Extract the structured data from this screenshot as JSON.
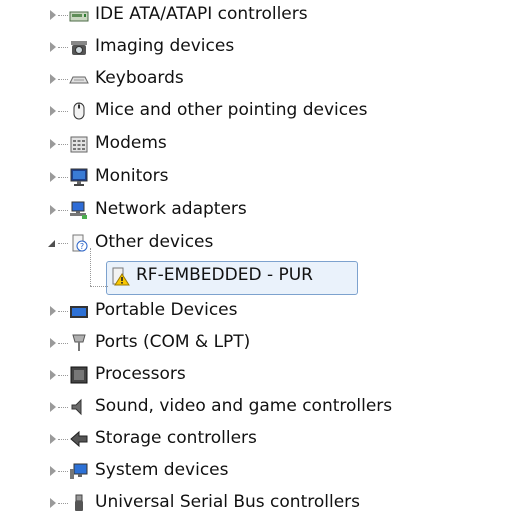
{
  "devices": [
    {
      "label": "IDE ATA/ATAPI controllers",
      "icon": "disk-controller-icon"
    },
    {
      "label": "Imaging devices",
      "icon": "camera-icon"
    },
    {
      "label": "Keyboards",
      "icon": "keyboard-icon"
    },
    {
      "label": "Mice and other pointing devices",
      "icon": "mouse-icon"
    },
    {
      "label": "Modems",
      "icon": "modem-icon"
    },
    {
      "label": "Monitors",
      "icon": "monitor-icon"
    },
    {
      "label": "Network adapters",
      "icon": "network-adapter-icon"
    },
    {
      "label": "Other devices",
      "icon": "unknown-device-icon",
      "expanded": true
    },
    {
      "label": "RF-EMBEDDED - PUR",
      "icon": "warning-device-icon",
      "child": true,
      "selected": true
    },
    {
      "label": "Portable Devices",
      "icon": "portable-device-icon"
    },
    {
      "label": "Ports (COM & LPT)",
      "icon": "port-icon"
    },
    {
      "label": "Processors",
      "icon": "processor-icon"
    },
    {
      "label": "Sound, video and game controllers",
      "icon": "speaker-icon"
    },
    {
      "label": "Storage controllers",
      "icon": "storage-controller-icon"
    },
    {
      "label": "System devices",
      "icon": "system-device-icon"
    },
    {
      "label": "Universal Serial Bus controllers",
      "icon": "usb-icon"
    }
  ]
}
